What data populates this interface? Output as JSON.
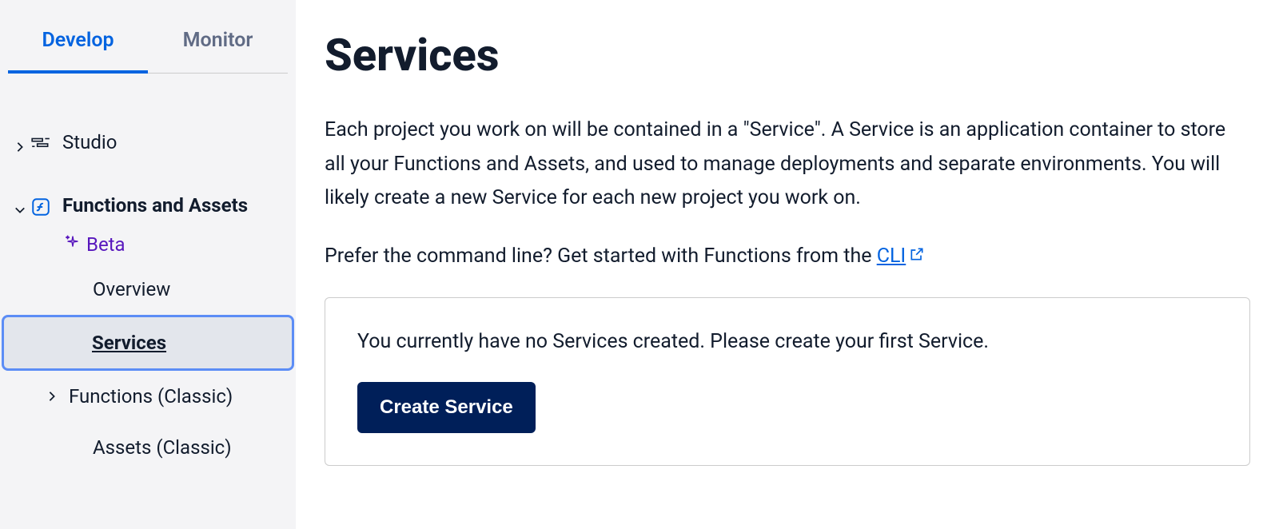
{
  "sidebar": {
    "tabs": {
      "develop": "Develop",
      "monitor": "Monitor"
    },
    "items": {
      "studio": "Studio",
      "functions_assets": "Functions and Assets",
      "beta": "Beta",
      "overview": "Overview",
      "services": "Services",
      "functions_classic": "Functions (Classic)",
      "assets_classic": "Assets (Classic)"
    }
  },
  "main": {
    "heading": "Services",
    "description": "Each project you work on will be contained in a \"Service\". A Service is an application container to store all your Functions and Assets, and used to manage deployments and separate environments. You will likely create a new Service for each new project you work on.",
    "cli_prefix": "Prefer the command line? Get started with Functions from the ",
    "cli_link": "CLI",
    "empty_state": "You currently have no Services created. Please create your first Service.",
    "create_button": "Create Service"
  }
}
